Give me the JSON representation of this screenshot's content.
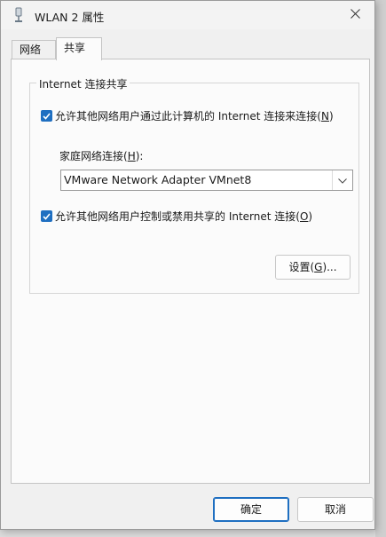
{
  "window": {
    "title": "WLAN 2 属性",
    "close_icon": "close-icon",
    "title_icon": "network-adapter-icon"
  },
  "tabs": [
    {
      "label": "网络",
      "selected": false
    },
    {
      "label": "共享",
      "selected": true
    }
  ],
  "group": {
    "title": "Internet 连接共享",
    "allow_share": {
      "label_pre": "允许其他网络用户通过此计算机的 Internet 连接来连接(",
      "accel": "N",
      "label_post": ")",
      "checked": true
    },
    "home_network": {
      "label_pre": "家庭网络连接(",
      "accel": "H",
      "label_post": "):",
      "value": "VMware Network Adapter VMnet8"
    },
    "allow_control": {
      "label_pre": "允许其他网络用户控制或禁用共享的 Internet 连接(",
      "accel": "O",
      "label_post": ")",
      "checked": true
    },
    "settings_button": {
      "pre": "设置(",
      "accel": "G",
      "post": ")..."
    }
  },
  "footer": {
    "ok_label": "确定",
    "cancel_label": "取消"
  },
  "colors": {
    "accent": "#1f6fc1",
    "dialog_bg": "#f0f0f0",
    "panel_bg": "#fbfbfb"
  }
}
